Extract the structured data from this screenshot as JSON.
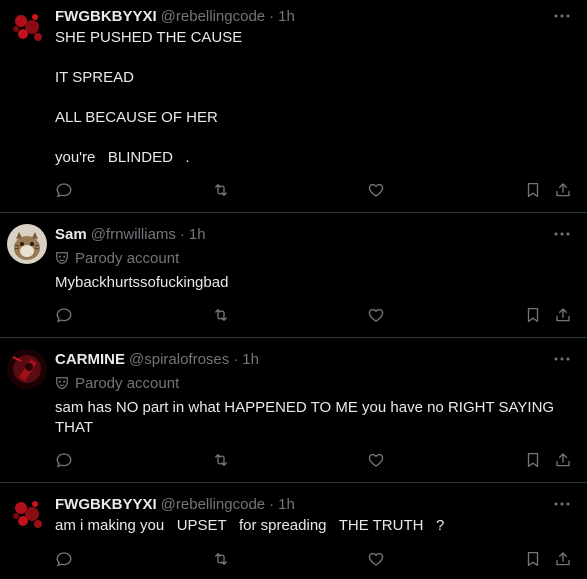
{
  "tweets": [
    {
      "name": "FWGBKBYYXI",
      "handle": "@rebellingcode",
      "time": "1h",
      "parody_label": "",
      "text": "SHE PUSHED THE CAUSE\n\nIT SPREAD\n\nALL BECAUSE OF HER\n\nyou're   BLINDED   ."
    },
    {
      "name": "Sam",
      "handle": "@frnwilliams",
      "time": "1h",
      "parody_label": "Parody account",
      "text": "Mybackhurtssofuckingbad"
    },
    {
      "name": "CARMINE",
      "handle": "@spiralofroses",
      "time": "1h",
      "parody_label": "Parody account",
      "text": "sam has NO part in what HAPPENED TO ME you have no RIGHT SAYING THAT"
    },
    {
      "name": "FWGBKBYYXI",
      "handle": "@rebellingcode",
      "time": "1h",
      "parody_label": "",
      "text": "am i making you   UPSET   for spreading   THE TRUTH   ?"
    }
  ],
  "separator": "·",
  "icons": {
    "reply": "reply-icon",
    "retweet": "retweet-icon",
    "like": "heart-icon",
    "bookmark": "bookmark-icon",
    "share": "share-icon",
    "more": "more-icon",
    "parody": "mask-icon"
  },
  "colors": {
    "background": "#000000",
    "text": "#e7e9ea",
    "muted": "#71767b",
    "divider": "#2f3336"
  }
}
